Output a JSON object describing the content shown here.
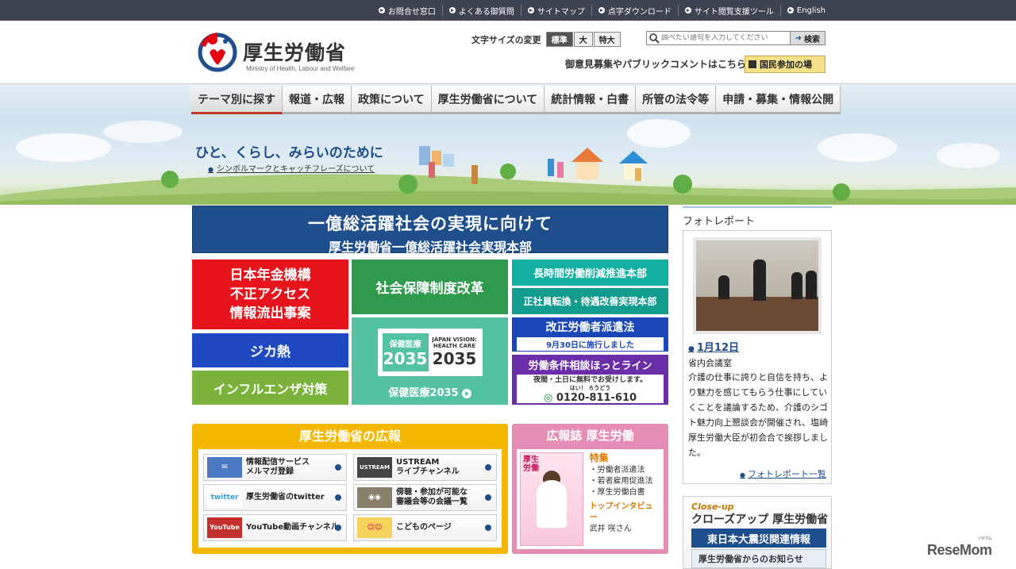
{
  "top_links": [
    "お問合せ窓口",
    "よくある御質問",
    "サイトマップ",
    "点字ダウンロード",
    "サイト閲覧支援ツール",
    "English"
  ],
  "header": {
    "title": "厚生労働省",
    "subtitle": "Ministry of Health, Labour and Welfare",
    "font_size_label": "文字サイズの変更",
    "font_sizes": [
      "標準",
      "大",
      "特大"
    ],
    "search_placeholder": "調べたい語句を入力してください",
    "search_button": "検索",
    "opinion_text": "御意見募集やパブリックコメントはこちら",
    "kokumin_button": "国民参加の場"
  },
  "nav": [
    "テーマ別に探す",
    "報道・広報",
    "政策について",
    "厚生労働省について",
    "統計情報・白書",
    "所管の法令等",
    "申請・募集・情報公開"
  ],
  "hero": {
    "catchphrase": "ひと、くらし、みらいのために",
    "link": "シンボルマークとキャッチフレーズについて"
  },
  "banner": {
    "line1": "一億総活躍社会の実現に向けて",
    "line2": "厚生労働省一億総活躍社会実現本部"
  },
  "tiles": {
    "pension": [
      "日本年金機構",
      "不正アクセス",
      "情報流出事案"
    ],
    "zika": "ジカ熱",
    "influenza": "インフルエンザ対策",
    "shakai": "社会保障制度改革",
    "hoken_card_left_small": "保健医療",
    "hoken_card_left_big": "2035",
    "hoken_card_right_small": "JAPAN VISION: HEALTH CARE",
    "hoken_card_right_big": "2035",
    "hoken_label": "保健医療2035",
    "chojikan": "長時間労働削減推進本部",
    "seishain": "正社員転換・待遇改善実現本部",
    "haken": "改正労働者派遣法",
    "haken_sub": "9月30日に施行しました",
    "hotline": "労働条件相談ほっとライン",
    "hotline_sub": "夜間・土日に無料でお受けします。",
    "hotline_tel": "0120-811-610",
    "hotline_ruby": "はい！ ろうどう"
  },
  "kouhou": {
    "title": "厚生労働省の広報",
    "items": [
      {
        "label": "情報配信サービス\nメルマガ登録",
        "icon": "mail-icon"
      },
      {
        "label": "USTREAM\nライブチャンネル",
        "icon": "ustream-icon"
      },
      {
        "label": "厚生労働省のtwitter",
        "icon": "twitter-icon"
      },
      {
        "label": "傍聴・参加が可能な\n審議会等の会議一覧",
        "icon": "meeting-icon"
      },
      {
        "label": "YouTube動画チャンネル",
        "icon": "youtube-icon"
      },
      {
        "label": "こどものページ",
        "icon": "kids-icon"
      }
    ],
    "icon_text": {
      "ustream": "USTREAM",
      "twitter": "twitter",
      "youtube": "YouTube"
    }
  },
  "magazine": {
    "title": "広報誌 厚生労働",
    "cover_title": "厚生\n労働",
    "tokushu": "特集",
    "topics": [
      "・労働者派遣法",
      "・若者雇用促進法",
      "・厚生労働白書"
    ],
    "interview_label": "トップインタビュー",
    "interview_name": "武井 咲さん"
  },
  "sidebar": {
    "photo_title": "フォトレポート",
    "date": "1月12日",
    "location": "省内会議室",
    "text": "介護の仕事に誇りと自信を持ち、より魅力を感じてもらう仕事にしていくことを議論するため、介護のシゴト魅力向上懇談会が開催され、塩崎厚生労働大臣が初会合で挨拶しました。",
    "more": "フォトレポート一覧",
    "closeup_en": "Close-up",
    "closeup_title": "クローズアップ 厚生労働省",
    "shinsai": "東日本大震災関連情報",
    "from": "厚生労働省からのお知らせ"
  },
  "watermark": "ReseMom",
  "watermark_small": "リセマム"
}
